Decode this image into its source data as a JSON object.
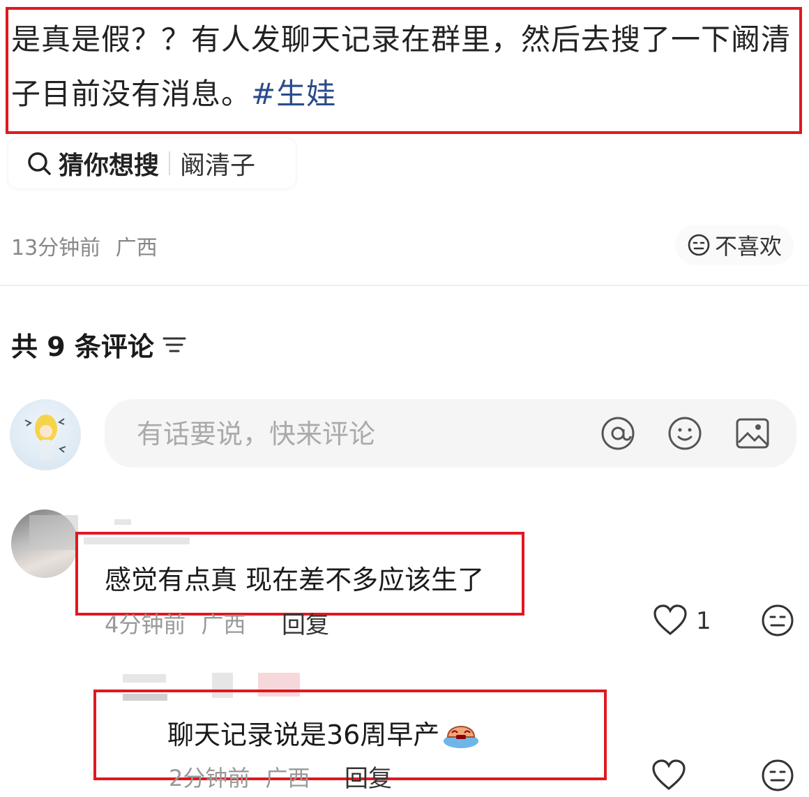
{
  "post": {
    "text": "是真是假？？有人发聊天记录在群里，然后去搜了一下阚清子目前没有消息。",
    "hashtag": "#生娃",
    "time": "13分钟前",
    "location": "广西",
    "dislike_label": "不喜欢"
  },
  "suggest": {
    "label": "猜你想搜",
    "term": "阚清子"
  },
  "comments_header": {
    "count_label": "共 9 条评论"
  },
  "comment_input": {
    "placeholder": "有话要说，快来评论"
  },
  "comments": [
    {
      "text": "感觉有点真 现在差不多应该生了",
      "time": "4分钟前",
      "location": "广西",
      "reply_label": "回复",
      "likes": "1"
    },
    {
      "text": "聊天记录说是36周早产",
      "time": "2分钟前",
      "location": "广西",
      "reply_label": "回复",
      "likes": ""
    }
  ],
  "colors": {
    "highlight_box": "#e01820",
    "hashtag": "#2a4c8a",
    "meta_text": "#888888"
  }
}
